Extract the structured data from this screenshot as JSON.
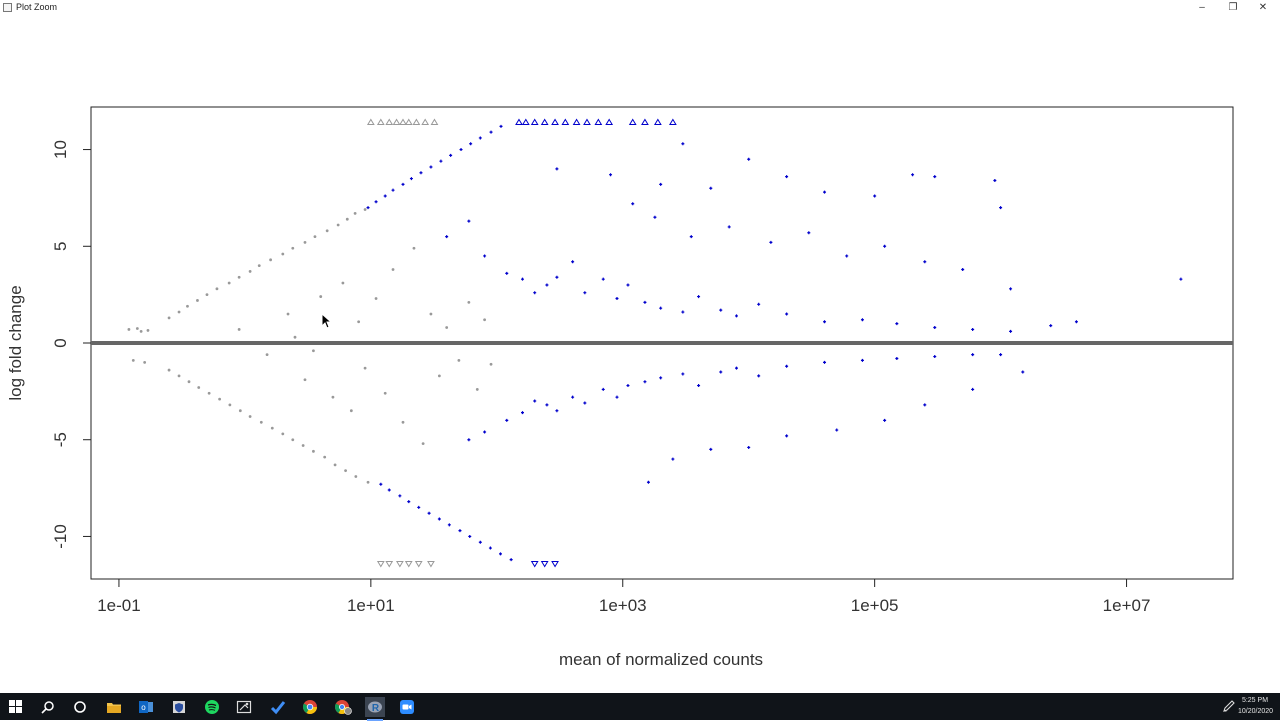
{
  "window": {
    "title": "Plot Zoom",
    "controls": [
      {
        "name": "minimize-button",
        "glyph": "–"
      },
      {
        "name": "restore-button",
        "glyph": "❐"
      },
      {
        "name": "close-button",
        "glyph": "✕"
      }
    ]
  },
  "chart_data": {
    "type": "scatter",
    "title": "",
    "xlabel": "mean of normalized counts",
    "ylabel": "log fold change",
    "x_scale": "log10",
    "xlim": [
      0.06,
      70000000
    ],
    "ylim": [
      -12.2,
      12.2
    ],
    "x_ticks": [
      {
        "value": 0.1,
        "label": "1e-01"
      },
      {
        "value": 10,
        "label": "1e+01"
      },
      {
        "value": 1000,
        "label": "1e+03"
      },
      {
        "value": 100000,
        "label": "1e+05"
      },
      {
        "value": 10000000,
        "label": "1e+07"
      }
    ],
    "y_ticks": [
      {
        "value": 10,
        "label": "10"
      },
      {
        "value": 5,
        "label": "5"
      },
      {
        "value": 0,
        "label": "0"
      },
      {
        "value": -5,
        "label": "-5"
      },
      {
        "value": -10,
        "label": "-10"
      }
    ],
    "reference_line": {
      "y": 0,
      "color": "#666666"
    },
    "grid": false,
    "legend": "none",
    "series": [
      {
        "color": "#999999",
        "marker": "dot",
        "points": [
          [
            0.12,
            0.7
          ],
          [
            0.14,
            0.75
          ],
          [
            0.15,
            0.6
          ],
          [
            0.17,
            0.65
          ],
          [
            0.13,
            -0.9
          ],
          [
            0.16,
            -1.0
          ],
          [
            0.25,
            1.3
          ],
          [
            0.3,
            1.6
          ],
          [
            0.35,
            1.9
          ],
          [
            0.42,
            2.2
          ],
          [
            0.5,
            2.5
          ],
          [
            0.6,
            2.8
          ],
          [
            0.75,
            3.1
          ],
          [
            0.9,
            3.4
          ],
          [
            1.1,
            3.7
          ],
          [
            1.3,
            4.0
          ],
          [
            1.6,
            4.3
          ],
          [
            2.0,
            4.6
          ],
          [
            2.4,
            4.9
          ],
          [
            3.0,
            5.2
          ],
          [
            3.6,
            5.5
          ],
          [
            4.5,
            5.8
          ],
          [
            5.5,
            6.1
          ],
          [
            6.5,
            6.4
          ],
          [
            7.5,
            6.7
          ],
          [
            9.0,
            6.9
          ],
          [
            0.25,
            -1.4
          ],
          [
            0.3,
            -1.7
          ],
          [
            0.36,
            -2.0
          ],
          [
            0.43,
            -2.3
          ],
          [
            0.52,
            -2.6
          ],
          [
            0.63,
            -2.9
          ],
          [
            0.76,
            -3.2
          ],
          [
            0.92,
            -3.5
          ],
          [
            1.1,
            -3.8
          ],
          [
            1.35,
            -4.1
          ],
          [
            1.65,
            -4.4
          ],
          [
            2.0,
            -4.7
          ],
          [
            2.4,
            -5.0
          ],
          [
            2.9,
            -5.3
          ],
          [
            3.5,
            -5.6
          ],
          [
            4.3,
            -5.9
          ],
          [
            5.2,
            -6.3
          ],
          [
            6.3,
            -6.6
          ],
          [
            7.6,
            -6.9
          ],
          [
            9.5,
            -7.2
          ],
          [
            10,
            11.4
          ],
          [
            12,
            11.4
          ],
          [
            14,
            11.4
          ],
          [
            16,
            11.4
          ],
          [
            18,
            11.4
          ],
          [
            20,
            11.4
          ],
          [
            23,
            11.4
          ],
          [
            27,
            11.4
          ],
          [
            32,
            11.4
          ],
          [
            12,
            -11.4
          ],
          [
            14,
            -11.4
          ],
          [
            17,
            -11.4
          ],
          [
            20,
            -11.4
          ],
          [
            24,
            -11.4
          ],
          [
            30,
            -11.4
          ],
          [
            0.9,
            0.7
          ],
          [
            1.5,
            -0.6
          ],
          [
            2.2,
            1.5
          ],
          [
            3.0,
            -1.9
          ],
          [
            4.0,
            2.4
          ],
          [
            5.0,
            -2.8
          ],
          [
            2.5,
            0.3
          ],
          [
            3.5,
            -0.4
          ],
          [
            6.0,
            3.1
          ],
          [
            7.0,
            -3.5
          ],
          [
            8.0,
            1.1
          ],
          [
            9.0,
            -1.3
          ],
          [
            11,
            2.3
          ],
          [
            13,
            -2.6
          ],
          [
            15,
            3.8
          ],
          [
            18,
            -4.1
          ],
          [
            22,
            4.9
          ],
          [
            26,
            -5.2
          ],
          [
            30,
            1.5
          ],
          [
            35,
            -1.7
          ],
          [
            40,
            0.8
          ],
          [
            50,
            -0.9
          ],
          [
            60,
            2.1
          ],
          [
            70,
            -2.4
          ],
          [
            80,
            1.2
          ],
          [
            90,
            -1.1
          ]
        ]
      },
      {
        "color": "#0000cc",
        "marker": "plus",
        "points": [
          [
            9.5,
            7.0
          ],
          [
            11,
            7.3
          ],
          [
            13,
            7.6
          ],
          [
            15,
            7.9
          ],
          [
            18,
            8.2
          ],
          [
            21,
            8.5
          ],
          [
            25,
            8.8
          ],
          [
            30,
            9.1
          ],
          [
            36,
            9.4
          ],
          [
            43,
            9.7
          ],
          [
            52,
            10.0
          ],
          [
            62,
            10.3
          ],
          [
            74,
            10.6
          ],
          [
            90,
            10.9
          ],
          [
            108,
            11.2
          ],
          [
            12,
            -7.3
          ],
          [
            14,
            -7.6
          ],
          [
            17,
            -7.9
          ],
          [
            20,
            -8.2
          ],
          [
            24,
            -8.5
          ],
          [
            29,
            -8.8
          ],
          [
            35,
            -9.1
          ],
          [
            42,
            -9.4
          ],
          [
            51,
            -9.7
          ],
          [
            61,
            -10.0
          ],
          [
            74,
            -10.3
          ],
          [
            89,
            -10.6
          ],
          [
            107,
            -10.9
          ],
          [
            130,
            -11.2
          ],
          [
            150,
            11.4
          ],
          [
            170,
            11.4
          ],
          [
            200,
            11.4
          ],
          [
            240,
            11.4
          ],
          [
            290,
            11.4
          ],
          [
            350,
            11.4
          ],
          [
            430,
            11.4
          ],
          [
            520,
            11.4
          ],
          [
            640,
            11.4
          ],
          [
            780,
            11.4
          ],
          [
            1200,
            11.4
          ],
          [
            1500,
            11.4
          ],
          [
            1900,
            11.4
          ],
          [
            2500,
            11.4
          ],
          [
            200,
            -11.4
          ],
          [
            240,
            -11.4
          ],
          [
            290,
            -11.4
          ],
          [
            40,
            5.5
          ],
          [
            60,
            6.3
          ],
          [
            80,
            4.5
          ],
          [
            120,
            3.6
          ],
          [
            160,
            3.3
          ],
          [
            200,
            2.6
          ],
          [
            250,
            3.0
          ],
          [
            300,
            3.4
          ],
          [
            400,
            4.2
          ],
          [
            500,
            2.6
          ],
          [
            700,
            3.3
          ],
          [
            900,
            2.3
          ],
          [
            1100,
            3.0
          ],
          [
            1500,
            2.1
          ],
          [
            2000,
            1.8
          ],
          [
            3000,
            1.6
          ],
          [
            4000,
            2.4
          ],
          [
            6000,
            1.7
          ],
          [
            8000,
            1.4
          ],
          [
            12000,
            2.0
          ],
          [
            20000,
            1.5
          ],
          [
            40000,
            1.1
          ],
          [
            80000,
            1.2
          ],
          [
            150000,
            1.0
          ],
          [
            300000,
            0.8
          ],
          [
            600000,
            0.7
          ],
          [
            1200000,
            0.6
          ],
          [
            2500000,
            0.9
          ],
          [
            4000000,
            1.1
          ],
          [
            60,
            -5.0
          ],
          [
            80,
            -4.6
          ],
          [
            120,
            -4.0
          ],
          [
            160,
            -3.6
          ],
          [
            200,
            -3.0
          ],
          [
            250,
            -3.2
          ],
          [
            300,
            -3.5
          ],
          [
            400,
            -2.8
          ],
          [
            500,
            -3.1
          ],
          [
            700,
            -2.4
          ],
          [
            900,
            -2.8
          ],
          [
            1100,
            -2.2
          ],
          [
            1500,
            -2.0
          ],
          [
            2000,
            -1.8
          ],
          [
            3000,
            -1.6
          ],
          [
            4000,
            -2.2
          ],
          [
            6000,
            -1.5
          ],
          [
            8000,
            -1.3
          ],
          [
            12000,
            -1.7
          ],
          [
            20000,
            -1.2
          ],
          [
            40000,
            -1.0
          ],
          [
            80000,
            -0.9
          ],
          [
            150000,
            -0.8
          ],
          [
            300000,
            -0.7
          ],
          [
            600000,
            -0.6
          ],
          [
            1000000,
            -0.6
          ],
          [
            300,
            9.0
          ],
          [
            800,
            8.7
          ],
          [
            2000,
            8.2
          ],
          [
            3000,
            10.3
          ],
          [
            5000,
            8.0
          ],
          [
            10000,
            9.5
          ],
          [
            20000,
            8.6
          ],
          [
            40000,
            7.8
          ],
          [
            100000,
            7.6
          ],
          [
            200000,
            8.7
          ],
          [
            300000,
            8.6
          ],
          [
            900000,
            8.4
          ],
          [
            1000000,
            7.0
          ],
          [
            27000000,
            3.3
          ],
          [
            1200,
            7.2
          ],
          [
            1800,
            6.5
          ],
          [
            3500,
            5.5
          ],
          [
            7000,
            6.0
          ],
          [
            15000,
            5.2
          ],
          [
            30000,
            5.7
          ],
          [
            60000,
            4.5
          ],
          [
            120000,
            5.0
          ],
          [
            250000,
            4.2
          ],
          [
            500000,
            3.8
          ],
          [
            1200000,
            2.8
          ],
          [
            1600,
            -7.2
          ],
          [
            2500,
            -6.0
          ],
          [
            5000,
            -5.5
          ],
          [
            10000,
            -5.4
          ],
          [
            20000,
            -4.8
          ],
          [
            50000,
            -4.5
          ],
          [
            120000,
            -4.0
          ],
          [
            250000,
            -3.2
          ],
          [
            600000,
            -2.4
          ],
          [
            1500000,
            -1.5
          ]
        ]
      }
    ]
  },
  "taskbar": {
    "items": [
      {
        "name": "start-button-icon",
        "interactable": true
      },
      {
        "name": "search-icon",
        "interactable": true
      },
      {
        "name": "cortana-icon",
        "interactable": true
      },
      {
        "name": "file-explorer-icon",
        "interactable": true
      },
      {
        "name": "outlook-icon",
        "interactable": true
      },
      {
        "name": "security-shield-icon",
        "interactable": true
      },
      {
        "name": "spotify-icon",
        "interactable": true
      },
      {
        "name": "snipping-tool-icon",
        "interactable": true
      },
      {
        "name": "checkmark-app-icon",
        "interactable": true
      },
      {
        "name": "chrome-icon",
        "interactable": true
      },
      {
        "name": "chrome-profile-icon",
        "interactable": true
      },
      {
        "name": "r-app-icon",
        "interactable": true
      },
      {
        "name": "zoom-app-icon",
        "interactable": true
      }
    ],
    "clock_time": "5:25 PM",
    "clock_date": "10/20/2020"
  }
}
